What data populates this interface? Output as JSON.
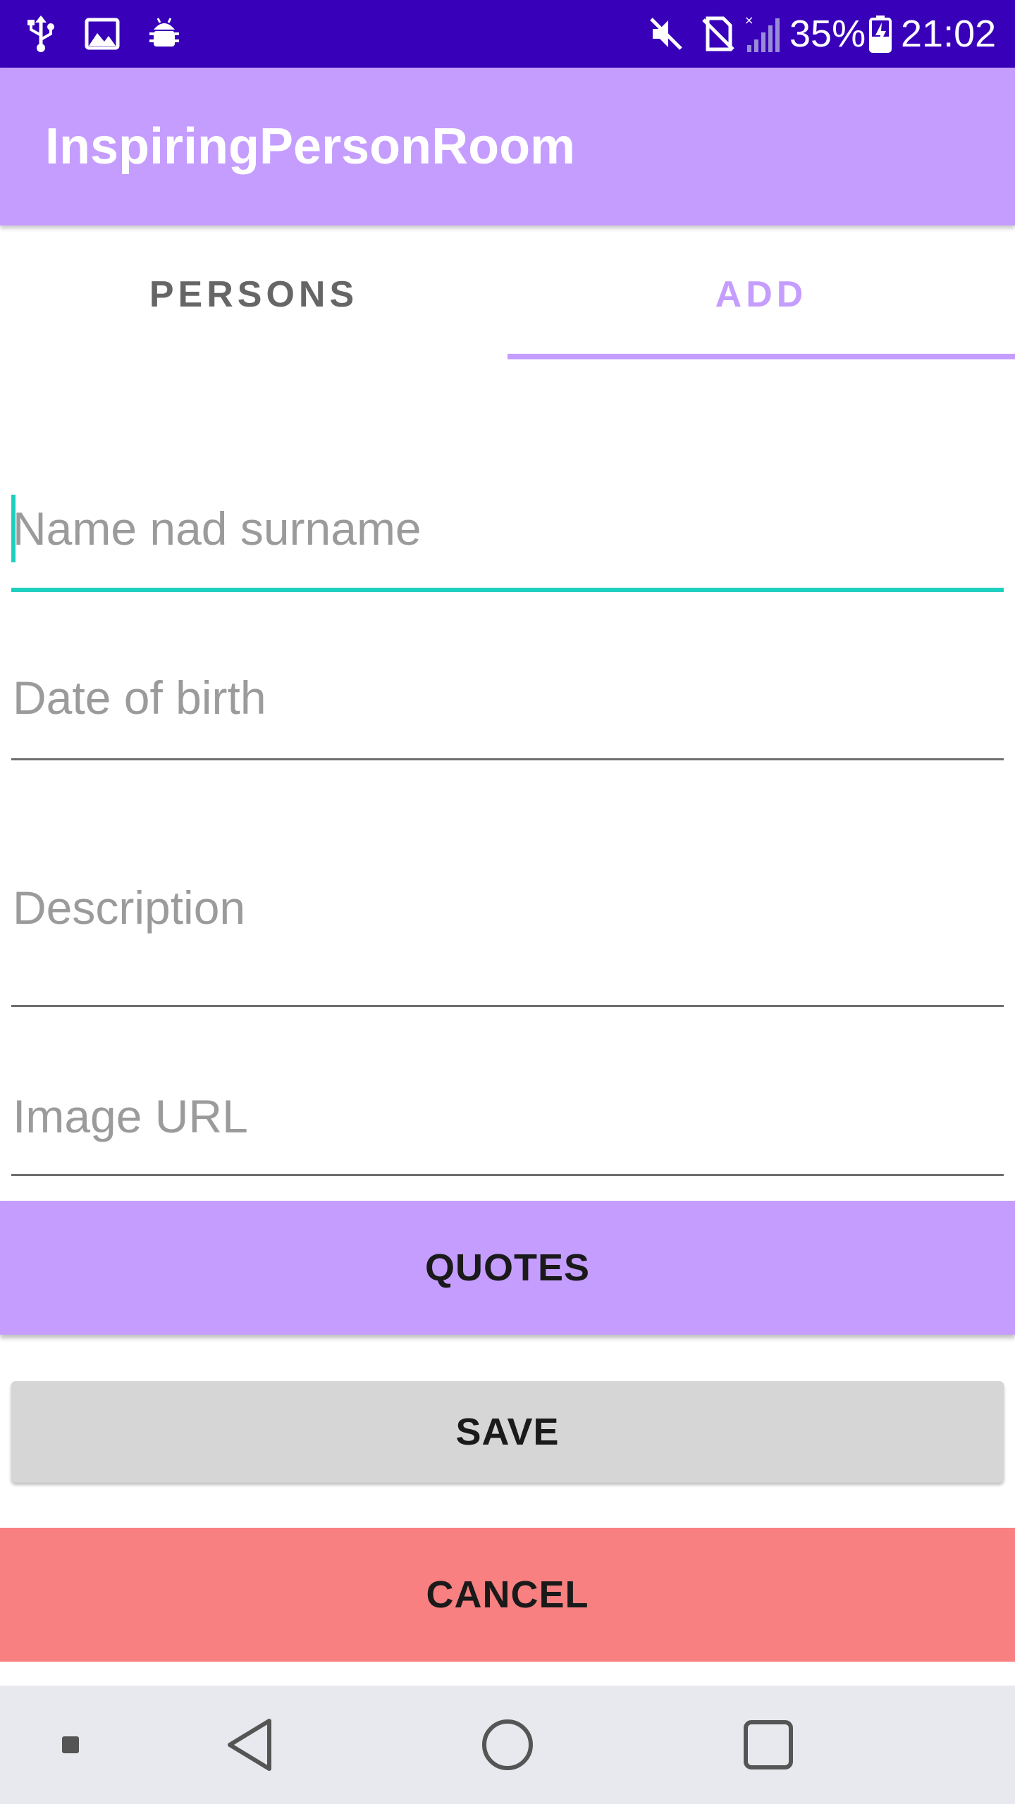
{
  "status_bar": {
    "icons": [
      "usb-icon",
      "image-icon",
      "android-debug-icon",
      "mute-icon",
      "no-sim-icon",
      "signal-icon",
      "battery-charging-icon"
    ],
    "battery_percent": "35%",
    "time": "21:02"
  },
  "app_bar": {
    "title": "InspiringPersonRoom"
  },
  "tabs": [
    {
      "label": "PERSONS",
      "selected": false
    },
    {
      "label": "ADD",
      "selected": true
    }
  ],
  "form": {
    "name_field": {
      "placeholder": "Name nad surname",
      "value": ""
    },
    "dob_field": {
      "placeholder": "Date of birth",
      "value": ""
    },
    "description_field": {
      "placeholder": "Description",
      "value": ""
    },
    "image_url_field": {
      "placeholder": "Image URL",
      "value": ""
    }
  },
  "buttons": {
    "quotes_label": "QUOTES",
    "save_label": "SAVE",
    "cancel_label": "CANCEL"
  },
  "nav_bar": {
    "items": [
      "menu-dot-icon",
      "back-icon",
      "home-icon",
      "recents-icon"
    ]
  },
  "colors": {
    "status_bar": "#3800b8",
    "primary": "#c59dff",
    "accent": "#1fcfbd",
    "cancel": "#f98080",
    "save": "#d6d6d6"
  }
}
